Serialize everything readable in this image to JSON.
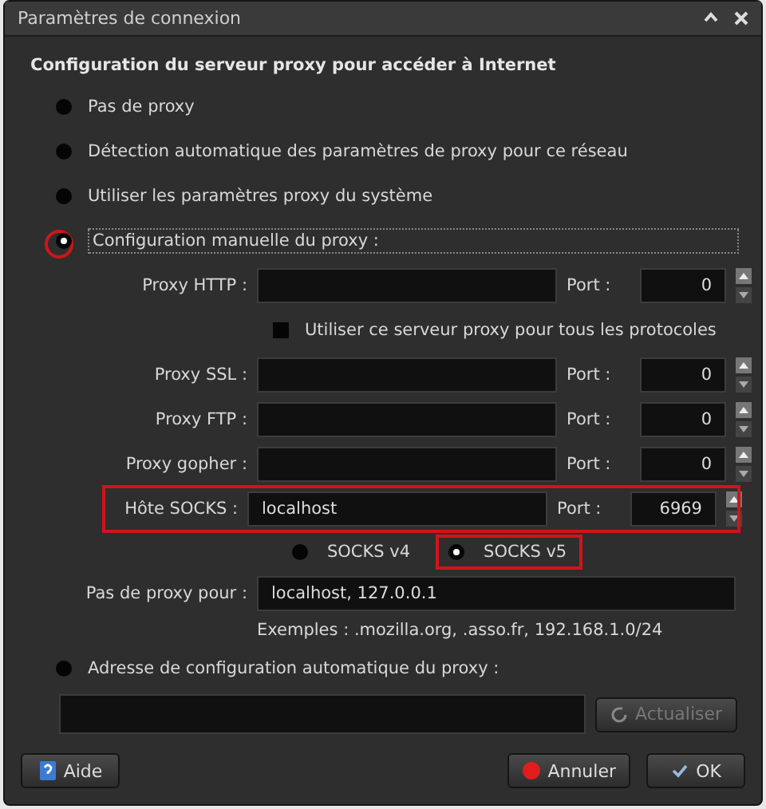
{
  "window": {
    "title": "Paramètres de connexion"
  },
  "heading": "Configuration du serveur proxy pour accéder à Internet",
  "modes": [
    {
      "kind": "simple",
      "label": "Pas de proxy",
      "selected": false,
      "highlighted": false
    },
    {
      "kind": "simple",
      "label": "Détection automatique des paramètres de proxy pour ce réseau",
      "selected": false,
      "highlighted": false
    },
    {
      "kind": "simple",
      "label": "Utiliser les paramètres proxy du système",
      "selected": false,
      "highlighted": false
    },
    {
      "kind": "manual",
      "label": "Configuration manuelle du proxy :",
      "selected": true,
      "highlighted": true
    },
    {
      "kind": "auto_url",
      "label": "Adresse de configuration automatique du proxy :",
      "selected": false,
      "highlighted": false
    }
  ],
  "proxies": [
    {
      "label": "Proxy HTTP :",
      "port_label": "Port :",
      "port": "0",
      "highlighted": false
    },
    {
      "label": "Proxy SSL :",
      "port_label": "Port :",
      "port": "0",
      "highlighted": false
    },
    {
      "label": "Proxy FTP :",
      "port_label": "Port :",
      "port": "0",
      "highlighted": false
    },
    {
      "label": "Proxy gopher :",
      "port_label": "Port :",
      "port": "0",
      "highlighted": false
    },
    {
      "label": "Hôte SOCKS :",
      "value": "localhost",
      "port_label": "Port :",
      "port": "6969",
      "highlighted": true
    }
  ],
  "share_all": {
    "label": "Utiliser ce serveur proxy pour tous les protocoles",
    "checked": false
  },
  "socks_versions": [
    {
      "label": "SOCKS v4",
      "selected": false,
      "highlighted": false
    },
    {
      "label": "SOCKS v5",
      "selected": true,
      "highlighted": true
    }
  ],
  "no_proxy": {
    "label": "Pas de proxy pour :",
    "value": "localhost, 127.0.0.1",
    "hint": "Exemples : .mozilla.org, .asso.fr, 192.168.1.0/24"
  },
  "refresh_button": {
    "label": "Actualiser",
    "disabled": true
  },
  "buttons": [
    {
      "kind": "help",
      "label": "Aide"
    },
    {
      "kind": "cancel",
      "label": "Annuler"
    },
    {
      "kind": "ok",
      "label": "OK"
    }
  ]
}
